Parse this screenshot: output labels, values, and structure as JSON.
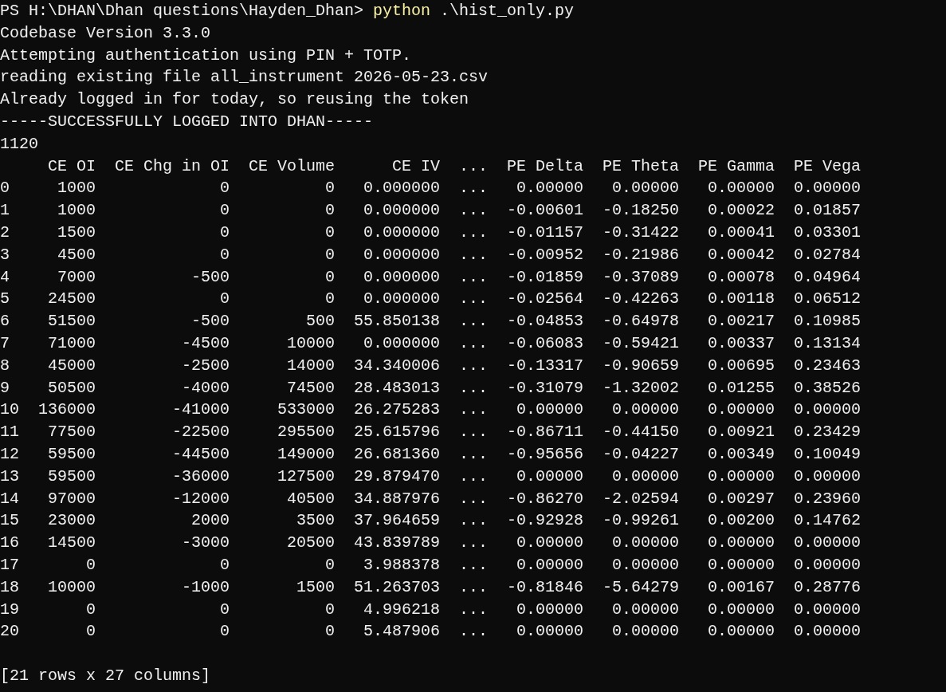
{
  "prompt": {
    "path": "PS H:\\DHAN\\Dhan questions\\Hayden_Dhan>",
    "command": "python",
    "args": ".\\hist_only.py"
  },
  "output_lines": [
    "Codebase Version 3.3.0",
    "Attempting authentication using PIN + TOTP.",
    "reading existing file all_instrument 2026-05-23.csv",
    "Already logged in for today, so reusing the token",
    "-----SUCCESSFULLY LOGGED INTO DHAN-----",
    "1120"
  ],
  "table": {
    "columns": [
      "CE OI",
      "CE Chg in OI",
      "CE Volume",
      "CE IV",
      "...",
      "PE Delta",
      "PE Theta",
      "PE Gamma",
      "PE Vega"
    ],
    "rows": [
      {
        "index": "0",
        "values": [
          "1000",
          "0",
          "0",
          "0.000000",
          "...",
          "0.00000",
          "0.00000",
          "0.00000",
          "0.00000"
        ]
      },
      {
        "index": "1",
        "values": [
          "1000",
          "0",
          "0",
          "0.000000",
          "...",
          "-0.00601",
          "-0.18250",
          "0.00022",
          "0.01857"
        ]
      },
      {
        "index": "2",
        "values": [
          "1500",
          "0",
          "0",
          "0.000000",
          "...",
          "-0.01157",
          "-0.31422",
          "0.00041",
          "0.03301"
        ]
      },
      {
        "index": "3",
        "values": [
          "4500",
          "0",
          "0",
          "0.000000",
          "...",
          "-0.00952",
          "-0.21986",
          "0.00042",
          "0.02784"
        ]
      },
      {
        "index": "4",
        "values": [
          "7000",
          "-500",
          "0",
          "0.000000",
          "...",
          "-0.01859",
          "-0.37089",
          "0.00078",
          "0.04964"
        ]
      },
      {
        "index": "5",
        "values": [
          "24500",
          "0",
          "0",
          "0.000000",
          "...",
          "-0.02564",
          "-0.42263",
          "0.00118",
          "0.06512"
        ]
      },
      {
        "index": "6",
        "values": [
          "51500",
          "-500",
          "500",
          "55.850138",
          "...",
          "-0.04853",
          "-0.64978",
          "0.00217",
          "0.10985"
        ]
      },
      {
        "index": "7",
        "values": [
          "71000",
          "-4500",
          "10000",
          "0.000000",
          "...",
          "-0.06083",
          "-0.59421",
          "0.00337",
          "0.13134"
        ]
      },
      {
        "index": "8",
        "values": [
          "45000",
          "-2500",
          "14000",
          "34.340006",
          "...",
          "-0.13317",
          "-0.90659",
          "0.00695",
          "0.23463"
        ]
      },
      {
        "index": "9",
        "values": [
          "50500",
          "-4000",
          "74500",
          "28.483013",
          "...",
          "-0.31079",
          "-1.32002",
          "0.01255",
          "0.38526"
        ]
      },
      {
        "index": "10",
        "values": [
          "136000",
          "-41000",
          "533000",
          "26.275283",
          "...",
          "0.00000",
          "0.00000",
          "0.00000",
          "0.00000"
        ]
      },
      {
        "index": "11",
        "values": [
          "77500",
          "-22500",
          "295500",
          "25.615796",
          "...",
          "-0.86711",
          "-0.44150",
          "0.00921",
          "0.23429"
        ]
      },
      {
        "index": "12",
        "values": [
          "59500",
          "-44500",
          "149000",
          "26.681360",
          "...",
          "-0.95656",
          "-0.04227",
          "0.00349",
          "0.10049"
        ]
      },
      {
        "index": "13",
        "values": [
          "59500",
          "-36000",
          "127500",
          "29.879470",
          "...",
          "0.00000",
          "0.00000",
          "0.00000",
          "0.00000"
        ]
      },
      {
        "index": "14",
        "values": [
          "97000",
          "-12000",
          "40500",
          "34.887976",
          "...",
          "-0.86270",
          "-2.02594",
          "0.00297",
          "0.23960"
        ]
      },
      {
        "index": "15",
        "values": [
          "23000",
          "2000",
          "3500",
          "37.964659",
          "...",
          "-0.92928",
          "-0.99261",
          "0.00200",
          "0.14762"
        ]
      },
      {
        "index": "16",
        "values": [
          "14500",
          "-3000",
          "20500",
          "43.839789",
          "...",
          "0.00000",
          "0.00000",
          "0.00000",
          "0.00000"
        ]
      },
      {
        "index": "17",
        "values": [
          "0",
          "0",
          "0",
          "3.988378",
          "...",
          "0.00000",
          "0.00000",
          "0.00000",
          "0.00000"
        ]
      },
      {
        "index": "18",
        "values": [
          "10000",
          "-1000",
          "1500",
          "51.263703",
          "...",
          "-0.81846",
          "-5.64279",
          "0.00167",
          "0.28776"
        ]
      },
      {
        "index": "19",
        "values": [
          "0",
          "0",
          "0",
          "4.996218",
          "...",
          "0.00000",
          "0.00000",
          "0.00000",
          "0.00000"
        ]
      },
      {
        "index": "20",
        "values": [
          "0",
          "0",
          "0",
          "5.487906",
          "...",
          "0.00000",
          "0.00000",
          "0.00000",
          "0.00000"
        ]
      }
    ]
  },
  "summary": "[21 rows x 27 columns]"
}
